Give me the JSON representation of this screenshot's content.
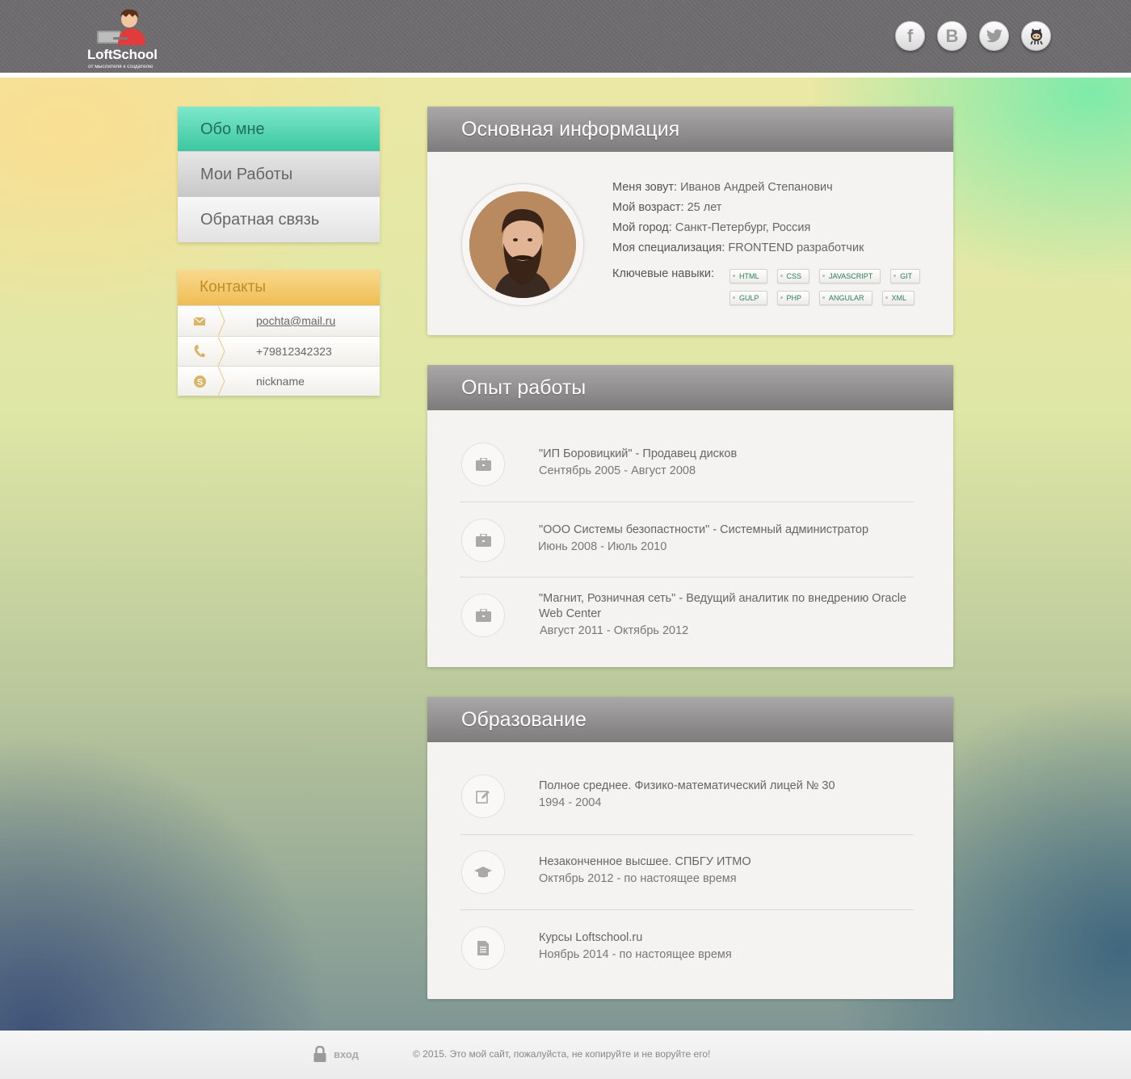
{
  "logo": {
    "name": "LoftSchool",
    "tagline": "от мыслителя к создателю"
  },
  "socials": [
    {
      "name": "facebook",
      "glyph": "f"
    },
    {
      "name": "vkontakte",
      "glyph": "B"
    },
    {
      "name": "twitter",
      "glyph": ""
    },
    {
      "name": "github",
      "glyph": ""
    }
  ],
  "nav": {
    "about": "Обо мне",
    "works": "Мои Работы",
    "feedback": "Обратная связь"
  },
  "contacts": {
    "title": "Контакты",
    "email": "pochta@mail.ru",
    "phone": "+79812342323",
    "skype": "nickname"
  },
  "info": {
    "title": "Основная информация",
    "rows": [
      {
        "label": "Меня зовут:",
        "value": "Иванов Андрей Степанович"
      },
      {
        "label": "Мой возраст:",
        "value": "25 лет"
      },
      {
        "label": "Мой город:",
        "value": "Санкт-Петербург, Россия"
      },
      {
        "label": "Моя специализация:",
        "value": "FRONTEND разработчик"
      }
    ],
    "skills_label": "Ключевые навыки:",
    "skills": [
      "HTML",
      "CSS",
      "JAVASCRIPT",
      "GIT",
      "GULP",
      "PHP",
      "ANGULAR",
      "XML"
    ]
  },
  "work": {
    "title": "Опыт работы",
    "items": [
      {
        "title": "\"ИП Боровицкий\" - Продавец дисков",
        "date": "Сентябрь 2005 - Август 2008",
        "icon": "briefcase-icon"
      },
      {
        "title": "\"ООО Системы безопастности\" - Системный администратор",
        "date": "Июнь 2008 - Июль 2010",
        "icon": "briefcase-icon"
      },
      {
        "title": "\"Магнит, Розничная сеть\" - Ведущий аналитик по внедрению Oracle Web Center",
        "date": "Август 2011 - Октябрь 2012",
        "icon": "briefcase-icon"
      }
    ]
  },
  "education": {
    "title": "Образование",
    "items": [
      {
        "title": "Полное среднее. Физико-математический лицей № 30",
        "date": "1994 - 2004",
        "icon": "pencil-icon"
      },
      {
        "title": "Незаконченное высшее. СПБГУ ИТМО",
        "date": "Октябрь 2012 - по настоящее время",
        "icon": "graduation-cap-icon"
      },
      {
        "title": "Курсы Loftschool.ru",
        "date": "Ноябрь 2014 - по настоящее время",
        "icon": "document-icon"
      }
    ]
  },
  "footer": {
    "login": "вход",
    "copyright": "© 2015. Это мой сайт, пожалуйста, не копируйте и не воруйте его!"
  },
  "colors": {
    "accent_green": "#3cc7a1",
    "contacts_gold": "#efbd55",
    "skill_text": "#2d7b63",
    "panel_head": "#7d7b7c"
  }
}
